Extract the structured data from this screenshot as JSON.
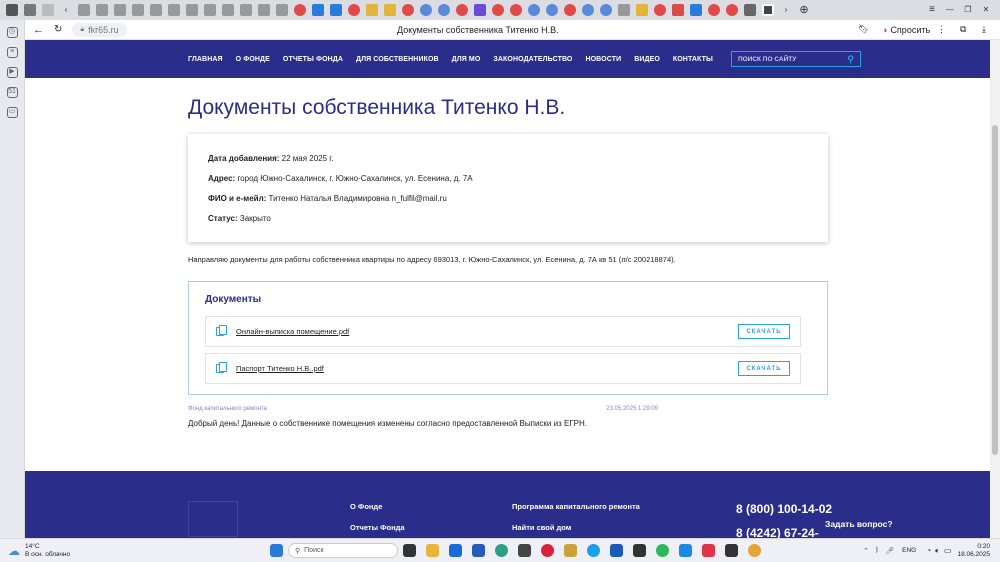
{
  "browser": {
    "url": "fkr65.ru",
    "tab_title": "Документы собственника Титенко Н.В.",
    "ask_label": "Спросить"
  },
  "nav": {
    "items": [
      "ГЛАВНАЯ",
      "О ФОНДЕ",
      "ОТЧЕТЫ ФОНДА",
      "ДЛЯ СОБСТВЕННИКОВ",
      "ДЛЯ МО",
      "ЗАКОНОДАТЕЛЬСТВО",
      "НОВОСТИ",
      "ВИДЕО",
      "КОНТАКТЫ"
    ],
    "search_placeholder": "ПОИСК ПО САЙТУ"
  },
  "page": {
    "title": "Документы собственника Титенко Н.В.",
    "date_label": "Дата добавления:",
    "date_value": "22 мая 2025 г.",
    "address_label": "Адрес:",
    "address_value": "город Южно-Сахалинск, г. Южно-Сахалинск, ул. Есенина, д. 7А",
    "fio_label": "ФИО и e-мейл:",
    "fio_value": "Титенко Наталья Владимировна n_fulfil@mail.ru",
    "status_label": "Статус:",
    "status_value": "Закрыто",
    "intro": "Направляю документы для работы собственника квартиры по адресу 693013, г. Южно-Сахалинск, ул. Есенина, д. 7А кв 51 (л/с 200218874).",
    "docs_title": "Документы",
    "doc1": "Онлайн-выписка помещение.pdf",
    "doc2": "Паспорт Титенко Н.В..pdf",
    "download_label": "СКАЧАТЬ",
    "reply_author": "Фонд капитального ремонта",
    "reply_time": "23.05.2025 1:29:09",
    "reply_text": "Добрый день! Данные о собственнике помещения изменены согласно предоставленной Выписки из ЕГРН."
  },
  "footer": {
    "link_about": "О Фонде",
    "link_reports": "Отчеты Фонда",
    "link_program": "Программа капитального ремонта",
    "link_find_house": "Найти свой дом",
    "phone1": "8 (800) 100-14-02",
    "phone2": "8 (4242) 67-24-",
    "ask": "Задать вопрос?"
  },
  "taskbar": {
    "weather_temp": "14°C",
    "weather_desc": "В осн. облачно",
    "search": "Поиск",
    "lang": "ENG",
    "time": "0:20",
    "date": "18.06.2025"
  },
  "colors": {
    "nav": "#2b2d8a",
    "accent": "#2aa0e6"
  }
}
